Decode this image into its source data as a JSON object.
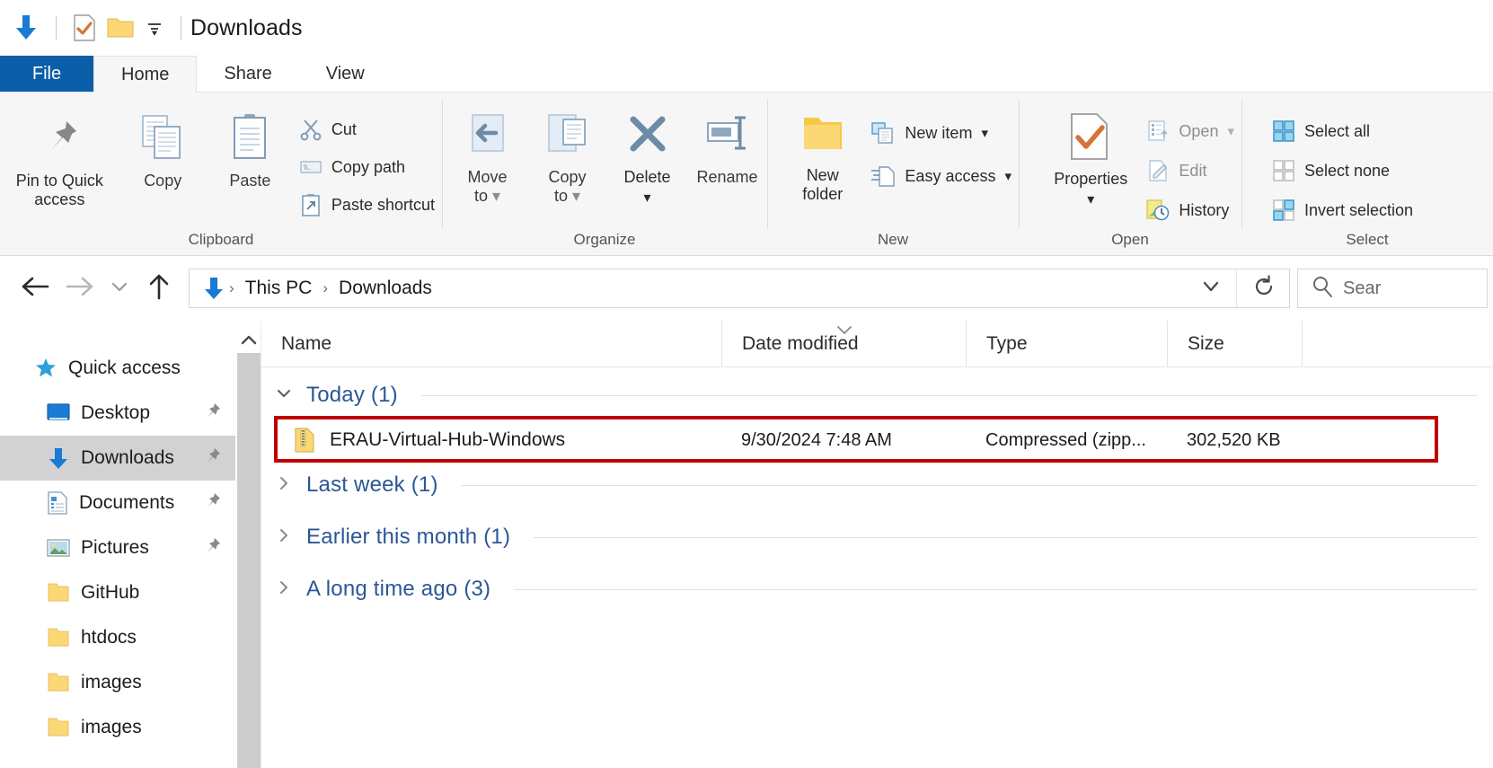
{
  "window": {
    "title": "Downloads",
    "quick_access_icons": [
      "download-arrow-icon",
      "properties-check-icon",
      "new-folder-icon",
      "customize-dropdown-icon"
    ]
  },
  "tabs": [
    {
      "label": "File",
      "state": "file-menu"
    },
    {
      "label": "Home",
      "state": "active"
    },
    {
      "label": "Share",
      "state": "normal"
    },
    {
      "label": "View",
      "state": "normal"
    }
  ],
  "ribbon": {
    "groups": [
      {
        "name": "Clipboard",
        "label": "Clipboard",
        "big_buttons": [
          {
            "label": "Pin to Quick\naccess",
            "line1": "Pin to Quick",
            "line2": "access",
            "icon": "pin-icon"
          },
          {
            "label": "Copy",
            "line1": "Copy",
            "line2": "",
            "icon": "copy-icon"
          },
          {
            "label": "Paste",
            "line1": "Paste",
            "line2": "",
            "icon": "paste-clipboard-icon"
          }
        ],
        "small_buttons": [
          {
            "label": "Cut",
            "icon": "scissors-icon"
          },
          {
            "label": "Copy path",
            "icon": "copy-path-icon"
          },
          {
            "label": "Paste shortcut",
            "icon": "paste-shortcut-icon"
          }
        ]
      },
      {
        "name": "Organize",
        "label": "Organize",
        "big_buttons": [
          {
            "label": "Move to",
            "line1": "Move",
            "line2": "to",
            "icon": "move-to-icon",
            "dropdown": true
          },
          {
            "label": "Copy to",
            "line1": "Copy",
            "line2": "to",
            "icon": "copy-to-icon",
            "dropdown": true
          },
          {
            "label": "Delete",
            "line1": "Delete",
            "line2": "",
            "icon": "delete-x-icon",
            "dropdown": true
          },
          {
            "label": "Rename",
            "line1": "Rename",
            "line2": "",
            "icon": "rename-icon"
          }
        ],
        "small_buttons": []
      },
      {
        "name": "New",
        "label": "New",
        "big_buttons": [
          {
            "label": "New folder",
            "line1": "New",
            "line2": "folder",
            "icon": "new-folder-icon"
          }
        ],
        "small_buttons": [
          {
            "label": "New item",
            "icon": "new-item-icon",
            "dropdown": true
          },
          {
            "label": "Easy access",
            "icon": "easy-access-icon",
            "dropdown": true
          }
        ]
      },
      {
        "name": "Open",
        "label": "Open",
        "big_buttons": [
          {
            "label": "Properties",
            "line1": "Properties",
            "line2": "",
            "icon": "properties-check-icon",
            "dropdown": true
          }
        ],
        "small_buttons": [
          {
            "label": "Open",
            "icon": "open-icon",
            "dropdown": true,
            "dim": true
          },
          {
            "label": "Edit",
            "icon": "edit-pencil-icon",
            "dim": true
          },
          {
            "label": "History",
            "icon": "history-clock-icon"
          }
        ]
      },
      {
        "name": "Select",
        "label": "Select",
        "big_buttons": [],
        "small_buttons": [
          {
            "label": "Select all",
            "icon": "select-all-icon"
          },
          {
            "label": "Select none",
            "icon": "select-none-icon"
          },
          {
            "label": "Invert selection",
            "icon": "invert-selection-icon"
          }
        ]
      }
    ]
  },
  "addressbar": {
    "back_icon": "back-arrow-icon",
    "forward_icon": "forward-arrow-icon",
    "recent_icon": "recent-locations-chevron-icon",
    "up_icon": "up-arrow-icon",
    "location_icon": "download-arrow-icon",
    "breadcrumbs": [
      "This PC",
      "Downloads"
    ],
    "separator": "›",
    "dropdown_icon": "address-dropdown-icon",
    "refresh_icon": "refresh-icon",
    "search_icon": "search-icon",
    "search_placeholder": "Sear"
  },
  "sidebar": {
    "items": [
      {
        "label": "Quick access",
        "icon": "quick-access-star-icon",
        "pinned": false,
        "selected": false,
        "indent": false
      },
      {
        "label": "Desktop",
        "icon": "desktop-icon",
        "pinned": true,
        "selected": false,
        "indent": true
      },
      {
        "label": "Downloads",
        "icon": "download-arrow-icon",
        "pinned": true,
        "selected": true,
        "indent": true
      },
      {
        "label": "Documents",
        "icon": "documents-icon",
        "pinned": true,
        "selected": false,
        "indent": true
      },
      {
        "label": "Pictures",
        "icon": "pictures-icon",
        "pinned": true,
        "selected": false,
        "indent": true
      },
      {
        "label": "GitHub",
        "icon": "folder-icon",
        "pinned": false,
        "selected": false,
        "indent": true
      },
      {
        "label": "htdocs",
        "icon": "folder-icon",
        "pinned": false,
        "selected": false,
        "indent": true
      },
      {
        "label": "images",
        "icon": "folder-icon",
        "pinned": false,
        "selected": false,
        "indent": true
      },
      {
        "label": "images",
        "icon": "folder-icon",
        "pinned": false,
        "selected": false,
        "indent": true
      }
    ],
    "scroll_up_icon": "scroll-up-arrow-icon"
  },
  "filelist": {
    "columns": [
      {
        "label": "Name",
        "sorted": false
      },
      {
        "label": "Date modified",
        "sorted": true,
        "sort_icon": "sort-descending-chevron-icon"
      },
      {
        "label": "Type",
        "sorted": false
      },
      {
        "label": "Size",
        "sorted": false
      }
    ],
    "groups": [
      {
        "label": "Today (1)",
        "expanded": true,
        "chevron": "chevron-down-icon",
        "rows": [
          {
            "name": "ERAU-Virtual-Hub-Windows",
            "icon": "zip-archive-icon",
            "date_modified": "9/30/2024 7:48 AM",
            "type": "Compressed (zipp...",
            "size": "302,520 KB",
            "annotated": true
          }
        ]
      },
      {
        "label": "Last week (1)",
        "expanded": false,
        "chevron": "chevron-right-icon",
        "rows": []
      },
      {
        "label": "Earlier this month (1)",
        "expanded": false,
        "chevron": "chevron-right-icon",
        "rows": []
      },
      {
        "label": "A long time ago (3)",
        "expanded": false,
        "chevron": "chevron-right-icon",
        "rows": []
      }
    ]
  },
  "annotation": {
    "color": "#c00000",
    "target": "ERAU-Virtual-Hub-Windows"
  },
  "colors": {
    "accent_blue": "#0b5ea8",
    "group_header_blue": "#2b5797",
    "folder_yellow": "#fbd775",
    "selection_grey": "#d2d2d2",
    "annotation_red": "#c00000"
  }
}
